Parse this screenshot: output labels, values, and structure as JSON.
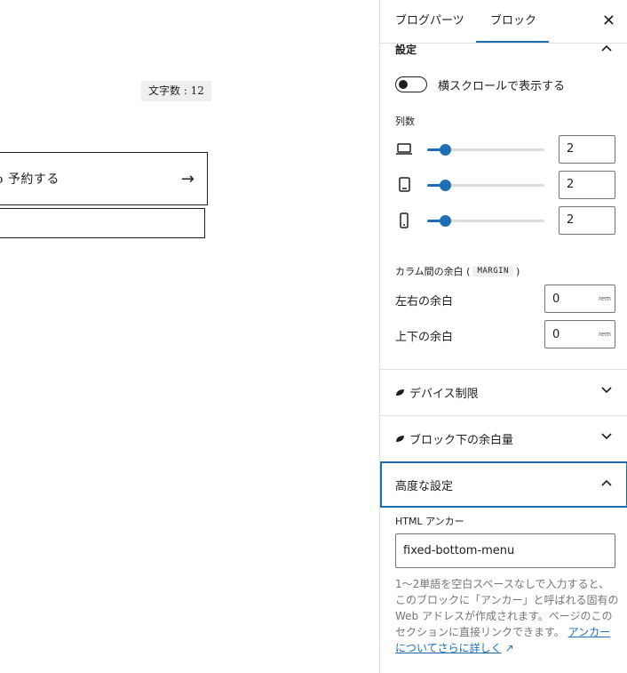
{
  "canvas": {
    "char_count": "文字数 : 12",
    "reserve_button_label": "o 予約する",
    "reserve_button_arrow": "→"
  },
  "sidebar": {
    "tabs": [
      {
        "label": "ブログパーツ"
      },
      {
        "label": "ブロック",
        "active": true
      }
    ],
    "close_glyph": "✕",
    "settings_section": {
      "title": "設定",
      "expanded": true,
      "toggle": {
        "label": "横スクロールで表示する",
        "checked": false
      },
      "columns_label": "列数",
      "sliders": [
        {
          "device": "laptop-icon",
          "value": "2",
          "fraction": 0.15
        },
        {
          "device": "tablet-icon",
          "value": "2",
          "fraction": 0.15
        },
        {
          "device": "mobile-icon",
          "value": "2",
          "fraction": 0.15
        }
      ],
      "margin_title_prefix": "カラム間の余白 (",
      "margin_title_code": "MARGIN",
      "margin_title_suffix": ")",
      "margins": [
        {
          "label": "左右の余白",
          "value": "0",
          "unit": "rem"
        },
        {
          "label": "上下の余白",
          "value": "0",
          "unit": "rem"
        }
      ]
    },
    "panels": [
      {
        "title": "デバイス制限",
        "expanded": false
      },
      {
        "title": "ブロック下の余白量",
        "expanded": false
      },
      {
        "title": "高度な設定",
        "expanded": true
      }
    ],
    "advanced": {
      "anchor_label": "HTML アンカー",
      "anchor_value": "fixed-bottom-menu",
      "help_text": "1〜2単語を空白スペースなしで入力すると、このブロックに「アンカー」と呼ばれる固有の Web アドレスが作成されます。ページのこのセクションに直接リンクできます。",
      "help_link": "アンカーについてさらに詳しく",
      "help_link_icon": "↗"
    },
    "accent_color": "#1c6fb7"
  }
}
